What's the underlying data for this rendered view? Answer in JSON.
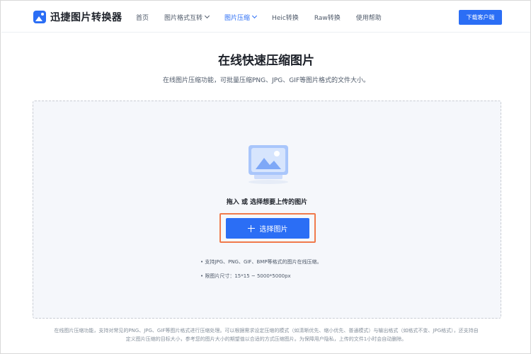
{
  "header": {
    "logo_text": "迅捷图片转换器",
    "nav": [
      {
        "label": "首页",
        "dropdown": false,
        "active": false
      },
      {
        "label": "图片格式互转",
        "dropdown": true,
        "active": false
      },
      {
        "label": "图片压缩",
        "dropdown": true,
        "active": true
      },
      {
        "label": "Heic转换",
        "dropdown": false,
        "active": false
      },
      {
        "label": "Raw转换",
        "dropdown": false,
        "active": false
      },
      {
        "label": "使用帮助",
        "dropdown": false,
        "active": false
      }
    ],
    "download_label": "下载客户端"
  },
  "main": {
    "title": "在线快速压缩图片",
    "subtitle": "在线图片压缩功能，可批量压缩PNG、JPG、GIF等图片格式的文件大小。"
  },
  "upload": {
    "hint": "拖入 或 选择想要上传的图片",
    "select_label": "选择图片",
    "note1": "• 支持JPG、PNG、GIF、BMP等格式的图片在线压缩。",
    "note2": "• 限图片尺寸：15*15 ~ 5000*5000px"
  },
  "footer": {
    "description": "在线图片压缩功能，支持对常见的PNG、JPG、GIF等图片格式进行压缩处理。可以根据需求设定压缩的模式（如清晰优先、缩小优先、普通模式）与输出格式（如格式不变、JPG格式），还支持自定义图片压缩的目标大小，参考您的图片大小的期望值以合适的方式压缩图片。为保障用户隐私，上传的文件1小时会自动删除。"
  },
  "colors": {
    "accent": "#2b6ef5",
    "highlight_border": "#f07a4b",
    "upload_bg": "#f5f7fb"
  },
  "icons": {
    "logo": "logo-picture-icon",
    "upload": "upload-image-illustration",
    "add": "plus-icon"
  }
}
